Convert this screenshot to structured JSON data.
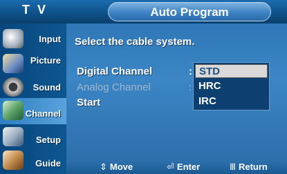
{
  "header": {
    "source_label": "T V",
    "menu_title": "Auto Program"
  },
  "sidebar": {
    "items": [
      {
        "label": "Input",
        "icon": "input-icon"
      },
      {
        "label": "Picture",
        "icon": "picture-icon"
      },
      {
        "label": "Sound",
        "icon": "sound-icon"
      },
      {
        "label": "Channel",
        "icon": "channel-icon",
        "active": true
      },
      {
        "label": "Setup",
        "icon": "setup-icon"
      },
      {
        "label": "Guide",
        "icon": "guide-icon"
      }
    ]
  },
  "main": {
    "prompt": "Select the cable system.",
    "rows": [
      {
        "label": "Digital Channel",
        "separator": ":",
        "value": "STD",
        "enabled": true
      },
      {
        "label": "Analog Channel",
        "separator": ":",
        "enabled": false
      },
      {
        "label": "Start",
        "enabled": true
      }
    ],
    "dropdown": {
      "options": [
        "STD",
        "HRC",
        "IRC"
      ],
      "selected": "STD"
    }
  },
  "footer": {
    "hints": [
      {
        "icon": "updown-arrows-icon",
        "label": "Move"
      },
      {
        "icon": "enter-icon",
        "label": "Enter"
      },
      {
        "icon": "menu-return-icon",
        "label": "Return"
      }
    ]
  },
  "colors": {
    "header": "#0d4f86",
    "panel": "#3c86c6",
    "sidebar": "#08467d",
    "selected_option_bg": "#d9d9d9",
    "selected_option_text": "#1c4f82"
  }
}
